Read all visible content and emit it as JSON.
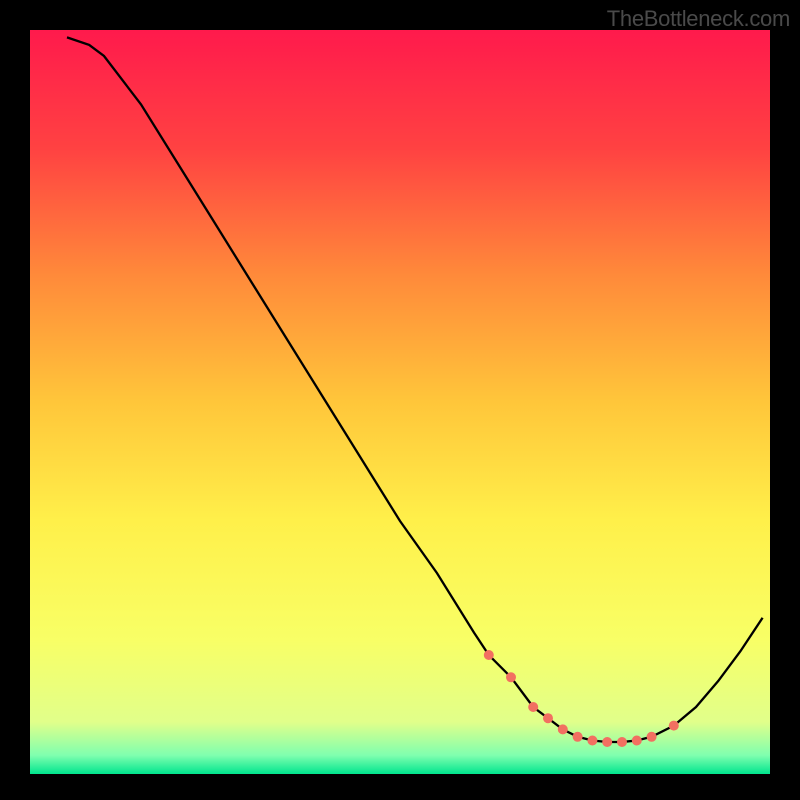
{
  "watermark": "TheBottleneck.com",
  "chart_data": {
    "type": "line",
    "title": "",
    "xlabel": "",
    "ylabel": "",
    "xlim": [
      0,
      100
    ],
    "ylim": [
      0,
      100
    ],
    "series": [
      {
        "name": "curve",
        "x": [
          5,
          8,
          10,
          15,
          20,
          25,
          30,
          35,
          40,
          45,
          50,
          55,
          60,
          62,
          65,
          68,
          70,
          72,
          74,
          76,
          78,
          80,
          82,
          84,
          87,
          90,
          93,
          96,
          99
        ],
        "y": [
          99,
          98,
          96.5,
          90,
          82,
          74,
          66,
          58,
          50,
          42,
          34,
          27,
          19,
          16,
          13,
          9,
          7.5,
          6,
          5,
          4.5,
          4.3,
          4.3,
          4.5,
          5,
          6.5,
          9,
          12.5,
          16.5,
          21
        ]
      }
    ],
    "markers": {
      "name": "valley-markers",
      "x": [
        62,
        65,
        68,
        70,
        72,
        74,
        76,
        78,
        80,
        82,
        84,
        87
      ],
      "y": [
        16,
        13,
        9,
        7.5,
        6,
        5,
        4.5,
        4.3,
        4.3,
        4.5,
        5,
        6.5
      ]
    },
    "background_gradient": {
      "stops": [
        {
          "offset": 0.0,
          "color": "#ff1a4c"
        },
        {
          "offset": 0.16,
          "color": "#ff4242"
        },
        {
          "offset": 0.33,
          "color": "#ff8a3a"
        },
        {
          "offset": 0.5,
          "color": "#ffc63a"
        },
        {
          "offset": 0.66,
          "color": "#fff04a"
        },
        {
          "offset": 0.82,
          "color": "#f8ff66"
        },
        {
          "offset": 0.93,
          "color": "#e1ff8a"
        },
        {
          "offset": 0.975,
          "color": "#7fffaf"
        },
        {
          "offset": 1.0,
          "color": "#00e58e"
        }
      ]
    }
  }
}
